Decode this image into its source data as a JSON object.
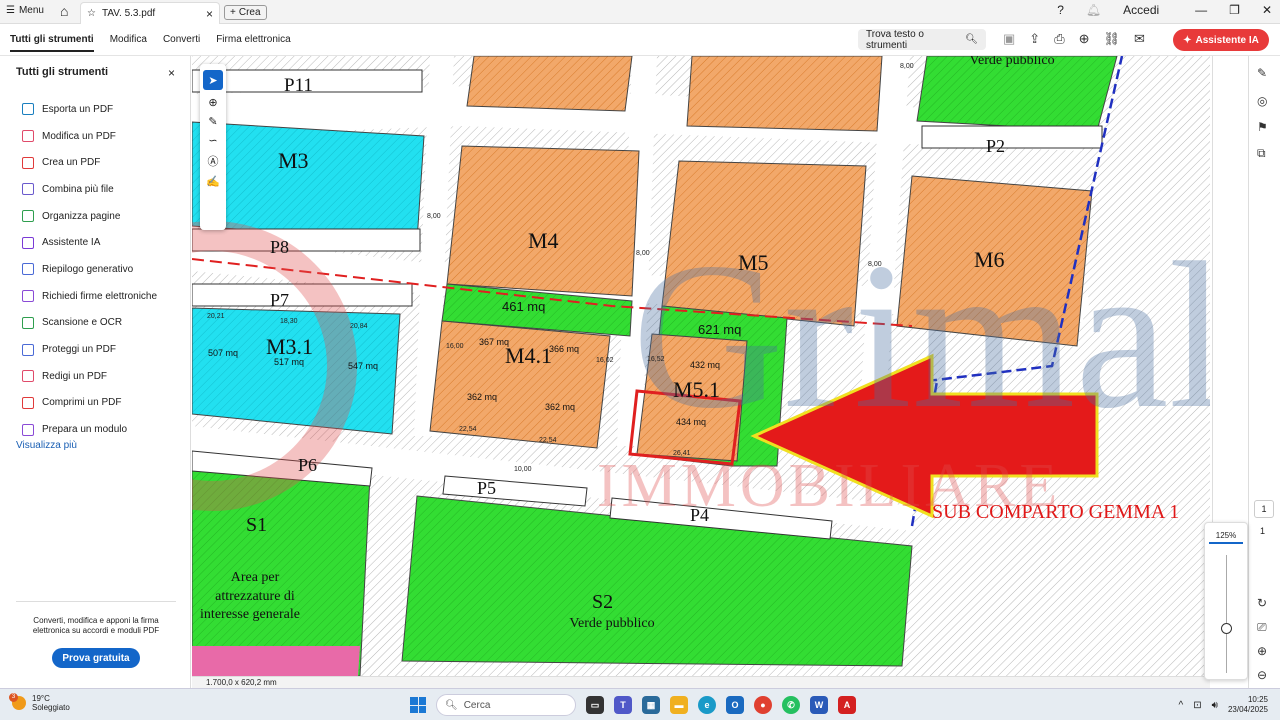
{
  "titlebar": {
    "menu_label": "Menu",
    "tab_title": "TAV. 5.3.pdf",
    "new_tab_label": "Crea",
    "signin_label": "Accedi"
  },
  "toolbar": {
    "menus": [
      "Tutti gli strumenti",
      "Modifica",
      "Converti",
      "Firma elettronica"
    ],
    "find_label": "Trova testo o strumenti",
    "ai_button": "Assistente IA"
  },
  "sidebar": {
    "title": "Tutti gli strumenti",
    "items": [
      {
        "label": "Esporta un PDF",
        "color": "#1a7fbf"
      },
      {
        "label": "Modifica un PDF",
        "color": "#e04a6a"
      },
      {
        "label": "Crea un PDF",
        "color": "#e03a3a"
      },
      {
        "label": "Combina più file",
        "color": "#6a5acd"
      },
      {
        "label": "Organizza pagine",
        "color": "#2e9e4e"
      },
      {
        "label": "Assistente IA",
        "color": "#7a3ad6"
      },
      {
        "label": "Riepilogo generativo",
        "color": "#4a6ad6"
      },
      {
        "label": "Richiedi firme elettroniche",
        "color": "#8a4ad6"
      },
      {
        "label": "Scansione e OCR",
        "color": "#2e9e4e"
      },
      {
        "label": "Proteggi un PDF",
        "color": "#4a6ad6"
      },
      {
        "label": "Redigi un PDF",
        "color": "#e04a6a"
      },
      {
        "label": "Comprimi un PDF",
        "color": "#e03a3a"
      },
      {
        "label": "Prepara un modulo",
        "color": "#8a4ad6"
      }
    ],
    "more_label": "Visualizza più",
    "promo_text": "Converti, modifica e apponi la firma elettronica su accordi e moduli PDF",
    "trial_button": "Prova gratuita"
  },
  "map": {
    "lots": [
      "P11",
      "M3",
      "P8",
      "P7",
      "M3.1",
      "P6",
      "S1",
      "M4",
      "M4.1",
      "P5",
      "M5",
      "M5.1",
      "P4",
      "S2",
      "M6",
      "P2"
    ],
    "areas": [
      "461 mq",
      "621 mq",
      "367 mq",
      "366 mq",
      "362 mq",
      "362 mq",
      "432 mq",
      "434 mq",
      "507 mq",
      "517 mq",
      "547 mq"
    ],
    "s1_text": [
      "Area per",
      "attrezzature di",
      "interesse generale"
    ],
    "s2_text": "Verde pubblico",
    "top_text": "Verde pubblico",
    "dims": [
      "8,00",
      "8,00",
      "8,00",
      "8,00",
      "10,00",
      "22,54",
      "22,54",
      "26,41",
      "20,21",
      "18,30",
      "20,84",
      "16,00",
      "16,02",
      "16,52"
    ],
    "callout": "SUB COMPARTO GEMMA 1",
    "watermark": "Grimaldi",
    "watermark_sub": "IMMOBILIARE",
    "accent_red": "#e02020",
    "lot_orange": "#f2a86a",
    "lot_green": "#33dd33",
    "lot_cyan": "#22e0f0"
  },
  "statusbar": {
    "page_size": "1.700,0 x 620,2 mm"
  },
  "viewer": {
    "zoom": "125%",
    "page": "1",
    "total_pages": "1"
  },
  "taskbar": {
    "weather_badge": "3",
    "temperature": "19°C",
    "weather": "Soleggiato",
    "search_placeholder": "Cerca",
    "time": "10:25",
    "date": "23/04/2025"
  }
}
